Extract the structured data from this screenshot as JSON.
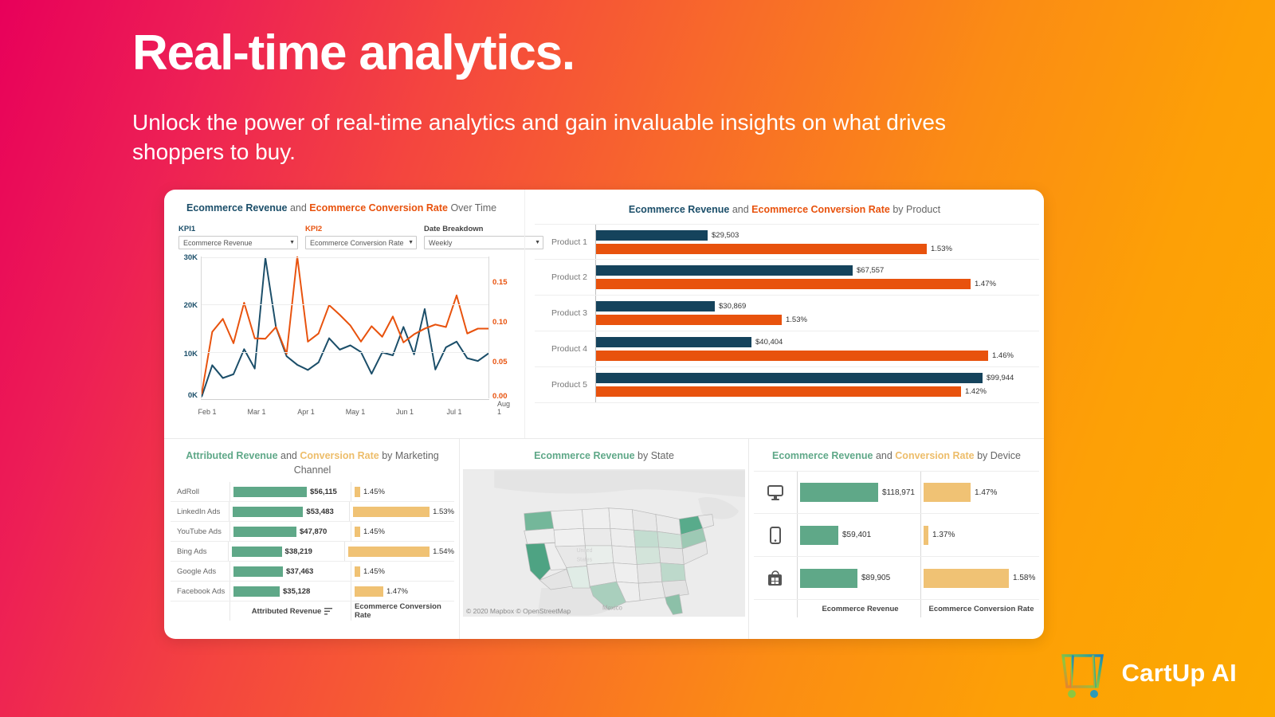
{
  "hero": {
    "title": "Real-time analytics.",
    "subtitle": "Unlock the power of real-time analytics and gain invaluable insights on what drives shoppers to buy."
  },
  "brand": {
    "name": "CartUp AI",
    "logo_icon": "shopping-cart-icon"
  },
  "colors": {
    "navy": "#15435c",
    "orange": "#e8520d",
    "green": "#5fa888",
    "amber": "#f0c274",
    "bg_left": "#e8005a",
    "bg_right": "#fcaa00"
  },
  "dashboard": {
    "line_panel": {
      "title_part1": "Ecommerce Revenue",
      "title_and": "and",
      "title_part2": "Ecommerce Conversion Rate",
      "title_suffix": "Over Time",
      "controls": [
        {
          "label": "KPI1",
          "value": "Ecommerce Revenue"
        },
        {
          "label": "KPI2",
          "value": "Ecommerce Conversion Rate"
        },
        {
          "label": "Date Breakdown",
          "value": "Weekly"
        }
      ]
    },
    "product_panel": {
      "title_part1": "Ecommerce Revenue",
      "title_and": "and",
      "title_part2": "Ecommerce Conversion Rate",
      "title_suffix": "by Product"
    },
    "channel_panel": {
      "title_part1": "Attributed Revenue",
      "title_and": "and",
      "title_part2": "Conversion Rate",
      "title_suffix": "by Marketing Channel",
      "footer_left": "Attributed Revenue",
      "footer_sort_icon": "sort-icon",
      "footer_right": "Ecommerce Conversion Rate"
    },
    "map_panel": {
      "title_part1": "Ecommerce Revenue",
      "title_suffix": "by State",
      "attribution": "© 2020 Mapbox  © OpenStreetMap",
      "map_label": "Mexico"
    },
    "device_panel": {
      "title_part1": "Ecommerce Revenue",
      "title_and": "and",
      "title_part2": "Conversion Rate",
      "title_suffix": "by Device",
      "footer_left": "Ecommerce Revenue",
      "footer_right": "Ecommerce Conversion Rate"
    }
  },
  "chart_data": [
    {
      "type": "line",
      "title": "Ecommerce Revenue and Ecommerce Conversion Rate Over Time",
      "xlabel": "",
      "ylabel": "Ecommerce Revenue",
      "y2label": "Ecommerce Conversion Rate",
      "ylim": [
        0,
        30000
      ],
      "y2lim": [
        0,
        0.175
      ],
      "yticks": [
        "0K",
        "10K",
        "20K",
        "30K"
      ],
      "y2ticks": [
        "0.00",
        "0.05",
        "0.10",
        "0.15"
      ],
      "xticks": [
        "Feb 1",
        "Mar 1",
        "Apr 1",
        "May 1",
        "Jun 1",
        "Jul 1",
        "Aug 1"
      ],
      "grid": true,
      "legend": "none",
      "series": [
        {
          "name": "Ecommerce Revenue",
          "color": "#1b4e69",
          "values": [
            300,
            7000,
            4300,
            5100,
            10400,
            6300,
            29700,
            15000,
            8900,
            7100,
            6000,
            7600,
            12700,
            10300,
            11200,
            9800,
            5200,
            9700,
            9100,
            15100,
            9300,
            18900,
            6100,
            10800,
            12000,
            8500,
            7900,
            9500
          ]
        },
        {
          "name": "Ecommerce Conversion Rate",
          "color": "#e8520d",
          "values": [
            0.005,
            0.082,
            0.098,
            0.068,
            0.118,
            0.074,
            0.0735,
            0.088,
            0.055,
            0.175,
            0.07,
            0.08,
            0.115,
            0.103,
            0.09,
            0.07,
            0.089,
            0.076,
            0.101,
            0.069,
            0.079,
            0.086,
            0.091,
            0.088,
            0.127,
            0.08,
            0.086,
            0.086
          ]
        }
      ]
    },
    {
      "type": "bar",
      "orientation": "horizontal",
      "title": "Ecommerce Revenue and Ecommerce Conversion Rate by Product",
      "categories": [
        "Product 1",
        "Product 2",
        "Product 3",
        "Product 4",
        "Product 5"
      ],
      "series": [
        {
          "name": "Ecommerce Revenue",
          "color": "#15435c",
          "values": [
            29503,
            67557,
            30869,
            40404,
            99944
          ],
          "labels": [
            "$29,503",
            "$67,557",
            "$30,869",
            "$40,404",
            "$99,944"
          ]
        },
        {
          "name": "Ecommerce Conversion Rate",
          "color": "#e8520d",
          "values": [
            1.53,
            1.47,
            1.53,
            1.46,
            1.42
          ],
          "labels": [
            "1.53%",
            "1.47%",
            "1.53%",
            "1.46%",
            "1.42%"
          ]
        }
      ],
      "bar_pixel_widths": {
        "revenue": [
          140,
          322,
          149,
          195,
          485
        ],
        "rate": [
          415,
          470,
          233,
          492,
          458
        ]
      }
    },
    {
      "type": "bar",
      "orientation": "horizontal",
      "title": "Attributed Revenue and Conversion Rate by Marketing Channel",
      "categories": [
        "AdRoll",
        "LinkedIn Ads",
        "YouTube Ads",
        "Bing Ads",
        "Google Ads",
        "Facebook Ads"
      ],
      "series": [
        {
          "name": "Attributed Revenue",
          "color": "#5fa888",
          "values": [
            56115,
            53483,
            47870,
            38219,
            37463,
            35128
          ],
          "labels": [
            "$56,115",
            "$53,483",
            "$47,870",
            "$38,219",
            "$37,463",
            "$35,128"
          ]
        },
        {
          "name": "Ecommerce Conversion Rate",
          "color": "#f0c274",
          "values": [
            1.45,
            1.53,
            1.45,
            1.54,
            1.45,
            1.47
          ],
          "labels": [
            "1.45%",
            "1.53%",
            "1.45%",
            "1.54%",
            "1.45%",
            "1.47%"
          ]
        }
      ],
      "bar_pixel_widths": {
        "revenue": [
          92,
          88,
          79,
          63,
          62,
          58
        ],
        "rate": [
          7,
          96,
          7,
          102,
          7,
          36
        ]
      }
    },
    {
      "type": "bar",
      "orientation": "horizontal",
      "title": "Ecommerce Revenue and Conversion Rate by Device",
      "categories": [
        "desktop-icon",
        "mobile-icon",
        "tablet-windows-icon"
      ],
      "series": [
        {
          "name": "Ecommerce Revenue",
          "color": "#5fa888",
          "values": [
            118971,
            59401,
            89905
          ],
          "labels": [
            "$118,971",
            "$59,401",
            "$89,905"
          ]
        },
        {
          "name": "Ecommerce Conversion Rate",
          "color": "#f0c274",
          "values": [
            1.47,
            1.37,
            1.58
          ],
          "labels": [
            "1.47%",
            "1.37%",
            "1.58%"
          ]
        }
      ],
      "bar_pixel_widths": {
        "revenue": [
          98,
          48,
          72
        ],
        "rate": [
          59,
          6,
          107
        ]
      }
    },
    {
      "type": "map",
      "title": "Ecommerce Revenue by State",
      "region": "United States",
      "highlighted_states": [
        "California",
        "Washington",
        "Texas",
        "New York",
        "Pennsylvania",
        "Illinois",
        "Indiana",
        "Ohio",
        "Georgia",
        "Florida",
        "North Carolina"
      ]
    }
  ]
}
